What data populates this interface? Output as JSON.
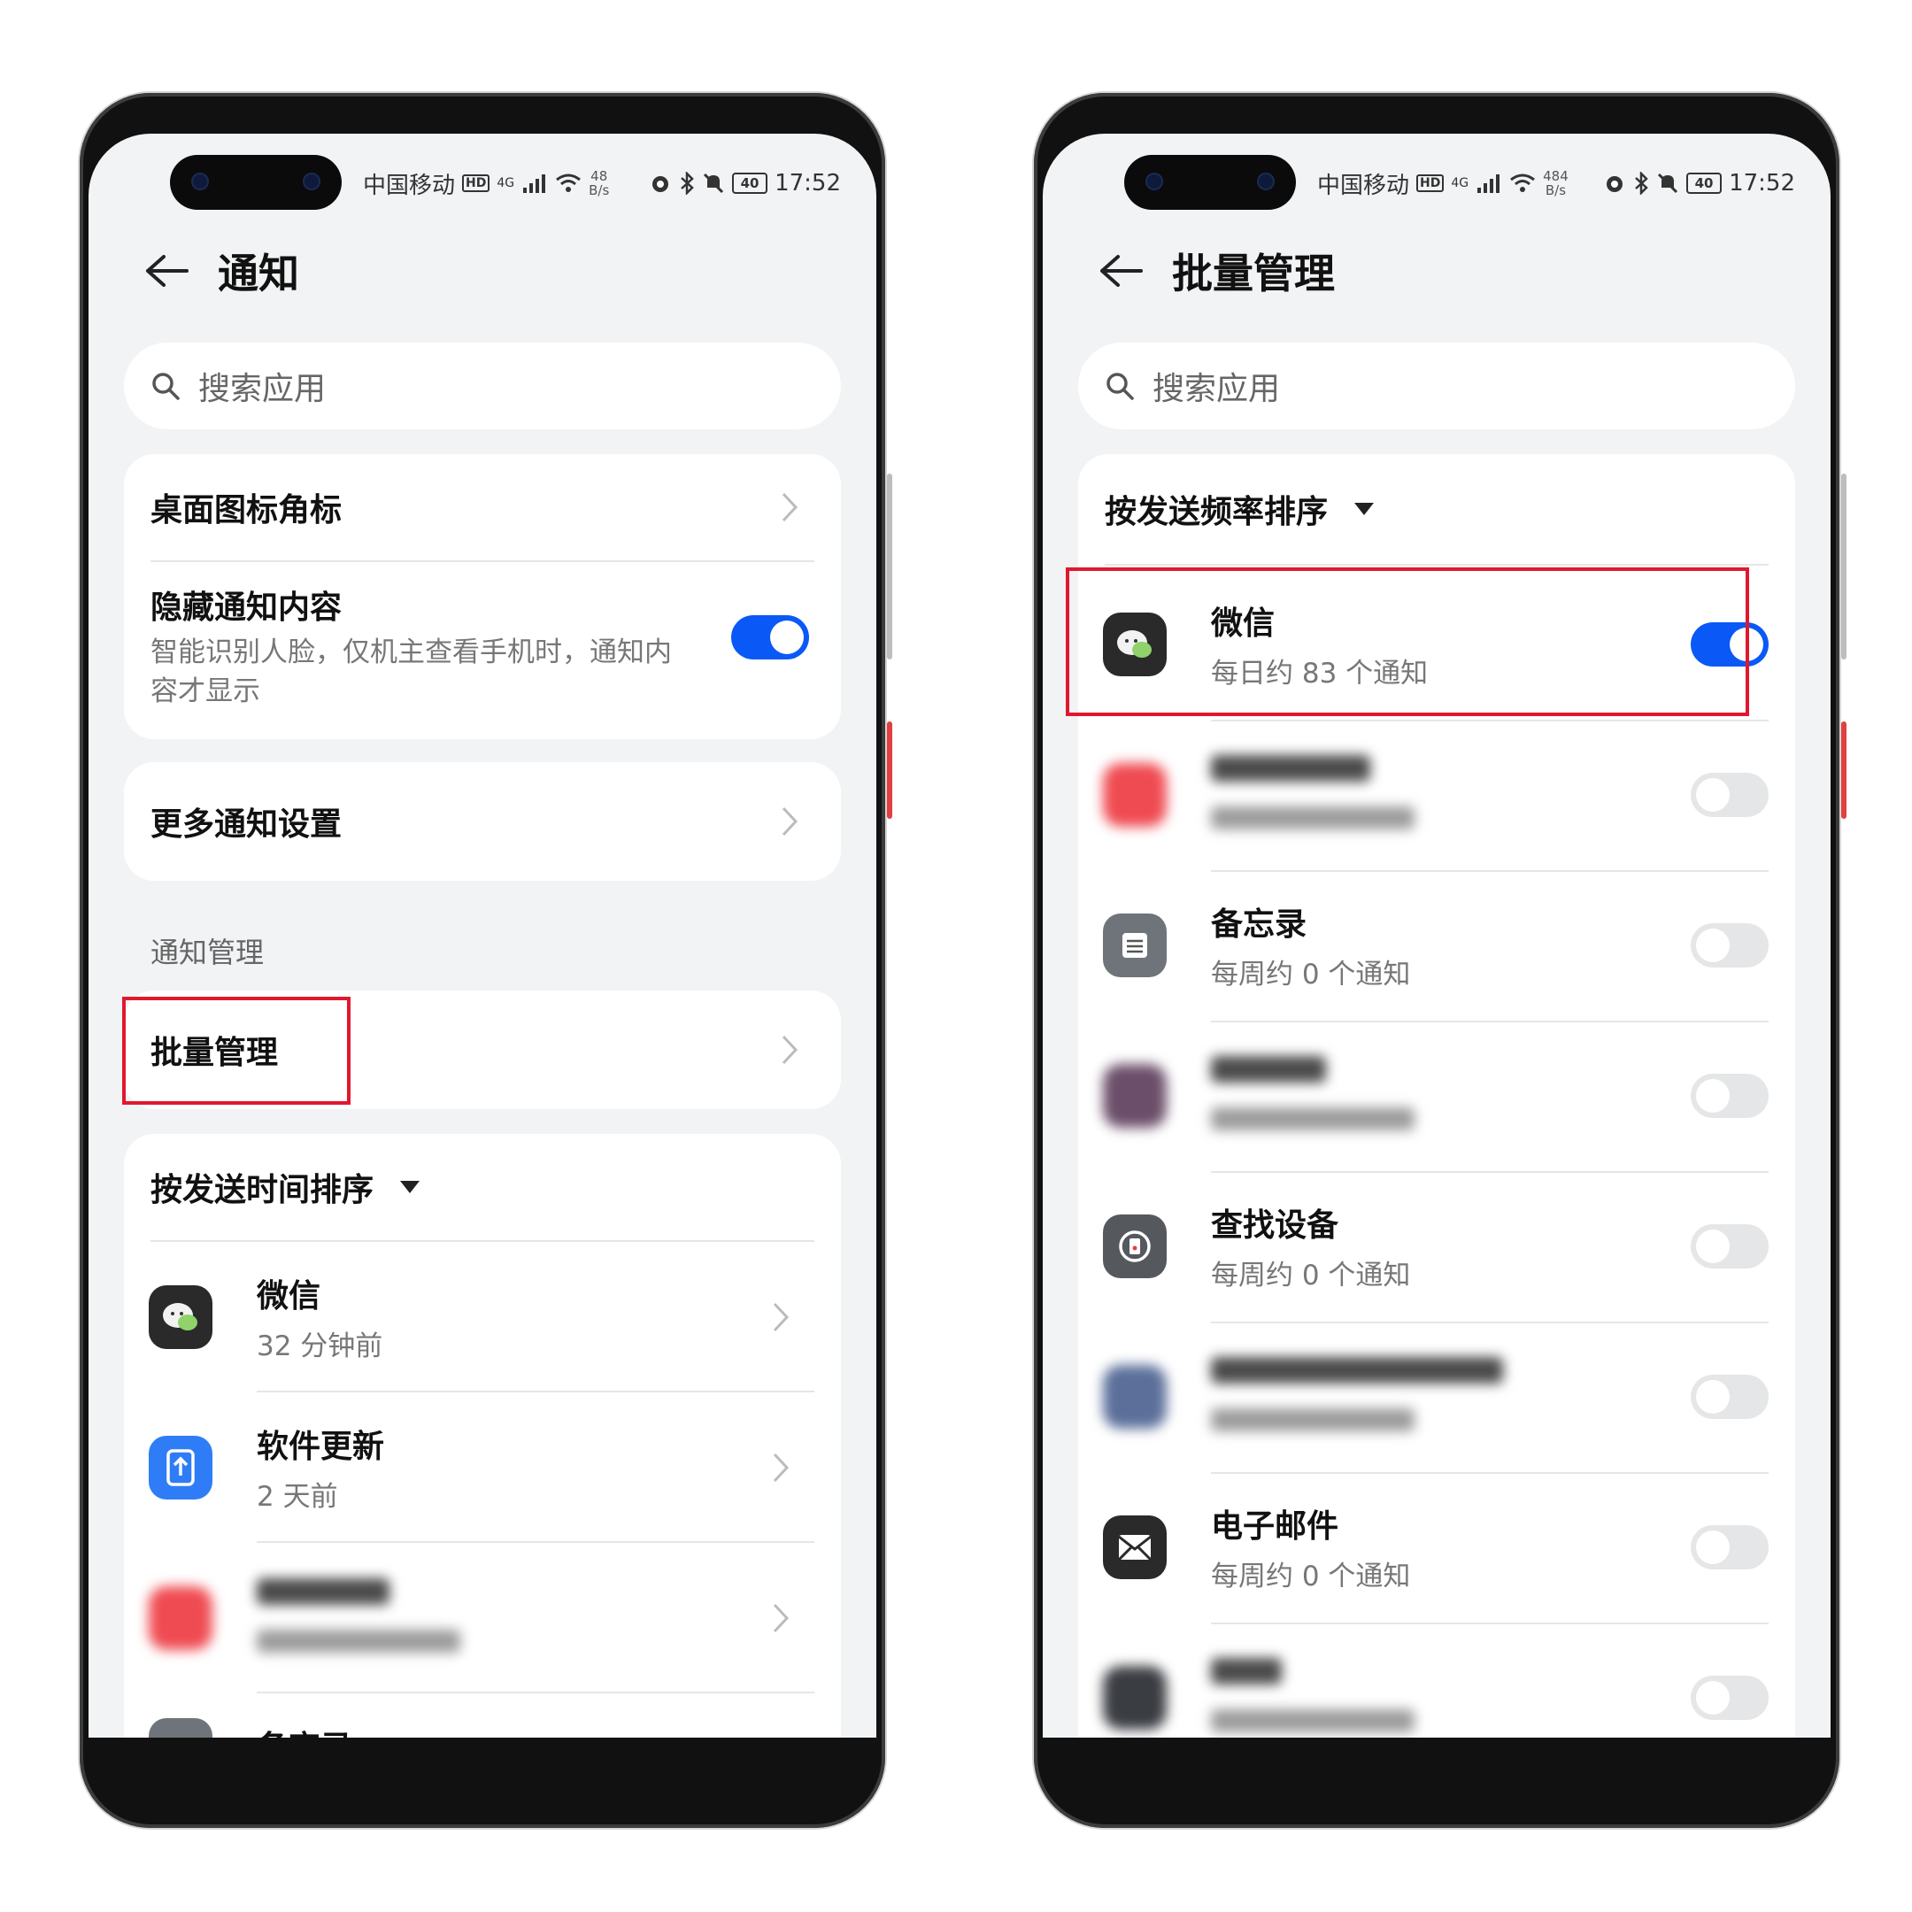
{
  "status": {
    "carrier": "中国移动",
    "hd": "HD",
    "network": "4G",
    "speed_left": "48",
    "speed_right": "484",
    "speed_unit": "B/s",
    "battery": "40",
    "time": "17:52"
  },
  "left": {
    "title": "通知",
    "search_placeholder": "搜索应用",
    "card1": {
      "badge_label": "桌面图标角标",
      "hide_label": "隐藏通知内容",
      "hide_desc": "智能识别人脸，仅机主查看手机时，通知内容才显示",
      "hide_on": true
    },
    "more_label": "更多通知设置",
    "section": "通知管理",
    "batch_label": "批量管理",
    "sort_label": "按发送时间排序",
    "apps": [
      {
        "name": "微信",
        "sub": "32 分钟前",
        "icon": "wechat-icon"
      },
      {
        "name": "软件更新",
        "sub": "2 天前",
        "icon": "software-update-icon"
      },
      {
        "name": "",
        "sub": "",
        "icon": "blurred-app-icon"
      },
      {
        "name": "备忘录",
        "sub": "",
        "icon": "notepad-icon"
      }
    ]
  },
  "right": {
    "title": "批量管理",
    "search_placeholder": "搜索应用",
    "sort_label": "按发送频率排序",
    "apps": [
      {
        "name": "微信",
        "sub": "每日约 83 个通知",
        "on": true,
        "icon": "wechat-icon"
      },
      {
        "name": "",
        "sub": "",
        "on": false,
        "icon": "blurred-app-icon"
      },
      {
        "name": "备忘录",
        "sub": "每周约 0 个通知",
        "on": false,
        "icon": "notepad-icon"
      },
      {
        "name": "",
        "sub": "",
        "on": false,
        "icon": "blurred-app-icon"
      },
      {
        "name": "查找设备",
        "sub": "每周约 0 个通知",
        "on": false,
        "icon": "find-device-icon"
      },
      {
        "name": "",
        "sub": "",
        "on": false,
        "icon": "blurred-app-icon"
      },
      {
        "name": "电子邮件",
        "sub": "每周约 0 个通知",
        "on": false,
        "icon": "email-icon"
      },
      {
        "name": "",
        "sub": "",
        "on": false,
        "icon": "blurred-app-icon"
      }
    ]
  },
  "colors": {
    "accent": "#0a59f7",
    "highlight": "#e0182e",
    "background": "#f1f3f5"
  }
}
